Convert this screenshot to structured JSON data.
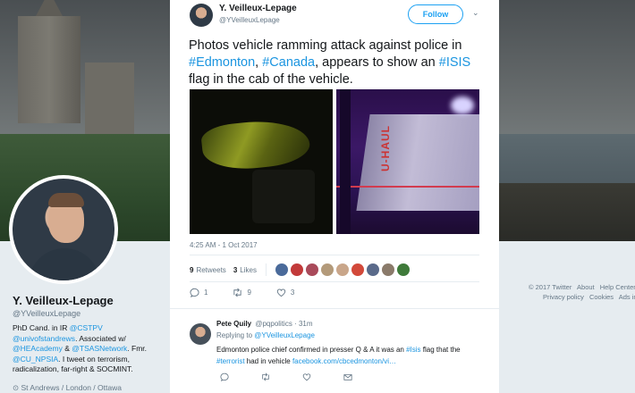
{
  "profile": {
    "name": "Y. Veilleux-Lepage",
    "handle": "@YVeilleuxLepage",
    "bio": {
      "p1": "PhD Cand. in IR ",
      "l1": "@CSTPV",
      "p2": " ",
      "l2": "@univofstandrews",
      "p3": ". Associated w/ ",
      "l3": "@HEAcademy",
      "p4": " & ",
      "l4": "@TSASNetwork",
      "p5": ". Fmr. ",
      "l5": "@CU_NPSIA",
      "p6": ". I tweet on terrorism, radicalization, far-right & SOCMINT."
    },
    "location": "St Andrews / London / Ottawa"
  },
  "footer": {
    "items": [
      "© 2017 Twitter",
      "About",
      "Help Center",
      "Privacy policy",
      "Cookies",
      "Ads info"
    ]
  },
  "tweet": {
    "name": "Y. Veilleux-Lepage",
    "handle": "@YVeilleuxLepage",
    "follow_label": "Follow",
    "text": {
      "t1": "Photos vehicle ramming attack against police in ",
      "h1": "#Edmonton",
      "t2": ", ",
      "h2": "#Canada",
      "t3": ", appears to show an ",
      "h3": "#ISIS",
      "t4": " flag in the cab of the vehicle."
    },
    "media_truck_text": "U-HAUL",
    "timestamp": "4:25 AM - 1 Oct 2017",
    "retweets": "9",
    "retweets_label": "Retweets",
    "likes": "3",
    "likes_label": "Likes",
    "actions": {
      "replies": "1",
      "retweets": "9",
      "likes": "3"
    }
  },
  "reply": {
    "name": "Pete Quily",
    "handle": "@pqpolitics",
    "time": "· 31m",
    "replying_to_label": "Replying to ",
    "replying_to": "@YVeilleuxLepage",
    "text": {
      "t1": "Edmonton police chief confirmed in presser Q & A it was an ",
      "l1": "#Isis",
      "t2": " flag that the ",
      "l2": "#terrorist",
      "t3": " had in vehicle ",
      "l3": "facebook.com/cbcedmonton/vi…"
    }
  },
  "colors": {
    "accent": "#1da1f2",
    "link": "#1b95e0",
    "like": "#e0245e",
    "retweet": "#17bf63"
  },
  "icons": [
    "reply-icon",
    "retweet-icon",
    "heart-icon",
    "chevron-down-icon",
    "location-icon",
    "dm-icon"
  ]
}
